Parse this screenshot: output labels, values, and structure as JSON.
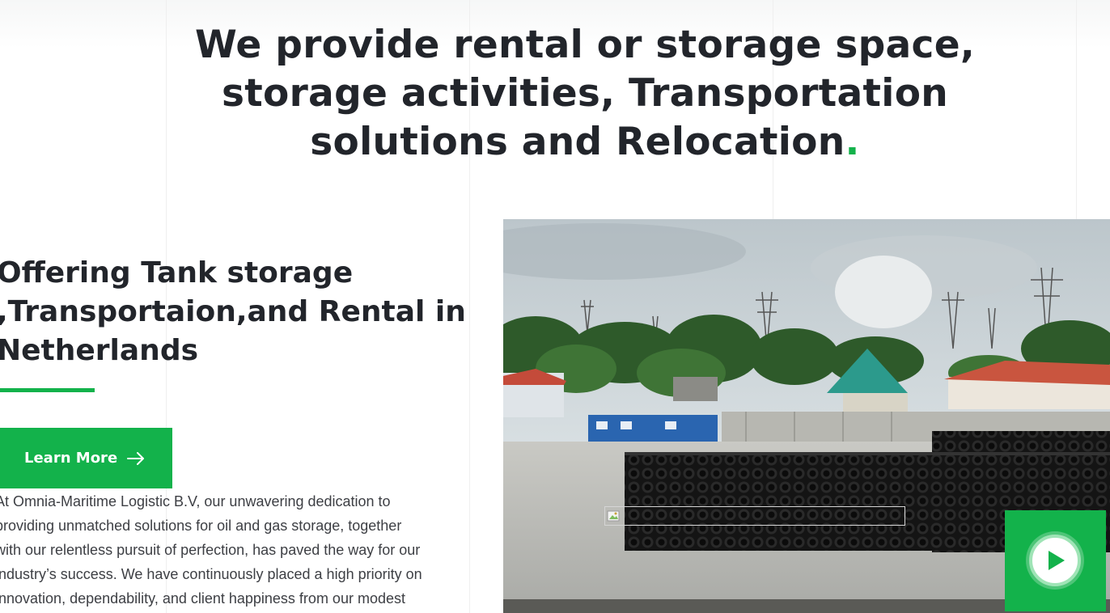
{
  "hero": {
    "heading_lines": [
      "We provide rental or storage space,",
      "storage activities, Transportation",
      "solutions and Relocation"
    ],
    "heading_dot": "."
  },
  "about": {
    "title_lines": [
      "Offering Tank storage",
      ",Transportaion,and Rental in",
      "Netherlands"
    ],
    "cta_label": "Learn More",
    "paragraph_lines": [
      "At  Omnia-Maritime Logistic B.V, our unwavering dedication to",
      "providing unmatched solutions for oil and gas storage, together",
      "with our relentless pursuit of perfection, has paved the way for our",
      "industry’s success. We have continuously placed a high priority on",
      "innovation, dependability, and client happiness from our modest"
    ]
  },
  "media": {
    "photo_icon": "storage-yard-photo",
    "play_icon": "play-icon",
    "broken_image_icon": "broken-image-icon"
  },
  "colors": {
    "accent": "#13b24b",
    "heading": "#22252b",
    "body_text": "#3d3f44"
  }
}
